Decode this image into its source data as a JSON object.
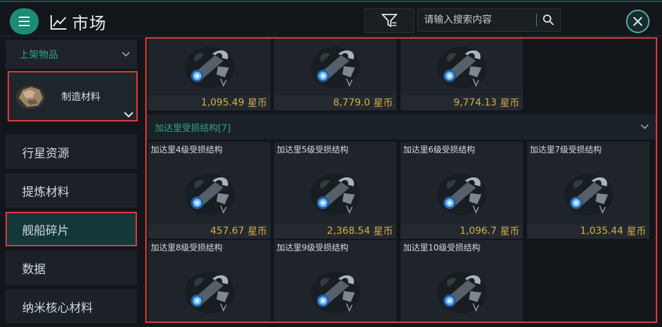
{
  "header": {
    "title": "市场",
    "search_placeholder": "请输入搜索内容"
  },
  "sidebar": {
    "category_header": "上架物品",
    "selected_category": "制造材料",
    "items": [
      {
        "label": "行星资源"
      },
      {
        "label": "提炼材料"
      },
      {
        "label": "舰船碎片"
      },
      {
        "label": "数据"
      },
      {
        "label": "纳米核心材料"
      }
    ]
  },
  "top_row": {
    "prices": [
      "1,095.49",
      "8,779.0",
      "9,774.13"
    ]
  },
  "currency": "星币",
  "group": {
    "title": "加达里受损结构[7]",
    "items": [
      {
        "name": "加达里4级受损结构",
        "price": "457.67"
      },
      {
        "name": "加达里5级受损结构",
        "price": "2,368.54"
      },
      {
        "name": "加达里6级受损结构",
        "price": "1,096.7"
      },
      {
        "name": "加达里7级受损结构",
        "price": "1,035.44"
      },
      {
        "name": "加达里8级受损结构",
        "price": ""
      },
      {
        "name": "加达里9级受损结构",
        "price": ""
      },
      {
        "name": "加达里10级受损结构",
        "price": ""
      }
    ]
  },
  "colors": {
    "accent": "#2fa58b",
    "highlight": "#e03a3e",
    "price": "#d4b04a"
  }
}
